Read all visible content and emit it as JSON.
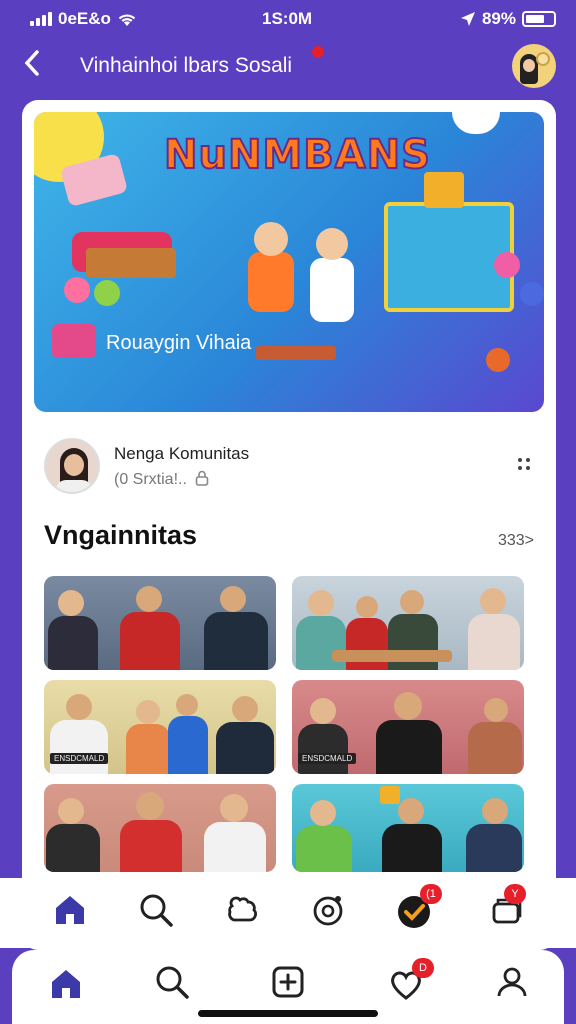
{
  "status": {
    "carrier": "0eE&o",
    "time": "1S:0M",
    "battery": "89%"
  },
  "header": {
    "title": "Vinhainhoi lbars Sosali"
  },
  "banner": {
    "title": "NuNMBANS",
    "subtitle": "Rouaygin Vihaia"
  },
  "community": {
    "name": "Nenga Komunitas",
    "sub": "(0 Srxtia!.."
  },
  "section": {
    "title": "Vngainnitas",
    "see_all": "333>"
  },
  "tiles": [
    {
      "label": ""
    },
    {
      "label": ""
    },
    {
      "label": "ENSDCMALD"
    },
    {
      "label": "ENSDCMALD"
    },
    {
      "label": ""
    },
    {
      "label": ""
    }
  ],
  "tab1": {
    "badge1": "(1",
    "badge2": "Y"
  },
  "tab2": {
    "badge": "D"
  },
  "colors": {
    "accent": "#5a3fc0",
    "nav_active": "#3b3aa8",
    "badge": "#e5202a"
  }
}
